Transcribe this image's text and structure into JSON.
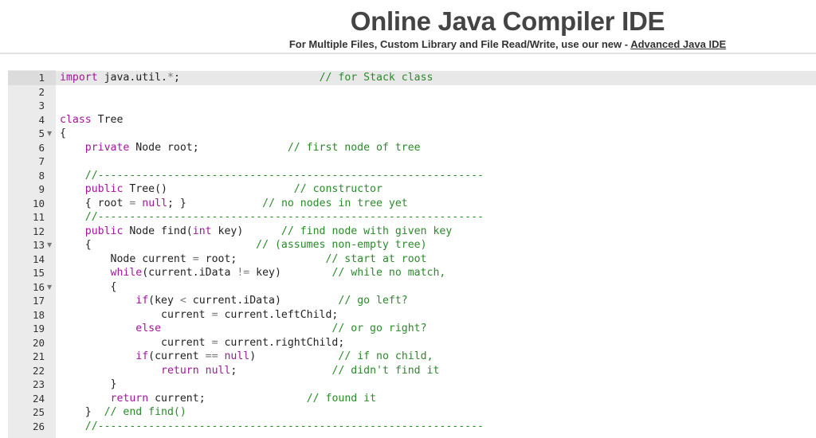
{
  "header": {
    "title": "Online Java Compiler IDE",
    "subtitle_prefix": "For Multiple Files, Custom Library and File Read/Write, use our new - ",
    "subtitle_link": "Advanced Java IDE"
  },
  "editor": {
    "lines": [
      {
        "n": "1",
        "fold": false,
        "tokens": [
          {
            "t": "kw",
            "v": "import"
          },
          {
            "t": "",
            "v": " java.util."
          },
          {
            "t": "op",
            "v": "*"
          },
          {
            "t": "",
            "v": ";"
          },
          {
            "t": "",
            "v": "                      "
          },
          {
            "t": "cm",
            "v": "// for Stack class"
          }
        ]
      },
      {
        "n": "2",
        "fold": false,
        "tokens": []
      },
      {
        "n": "3",
        "fold": false,
        "tokens": []
      },
      {
        "n": "4",
        "fold": false,
        "tokens": [
          {
            "t": "kw",
            "v": "class"
          },
          {
            "t": "",
            "v": " Tree"
          }
        ]
      },
      {
        "n": "5",
        "fold": true,
        "tokens": [
          {
            "t": "",
            "v": "{"
          }
        ]
      },
      {
        "n": "6",
        "fold": false,
        "tokens": [
          {
            "t": "",
            "v": "    "
          },
          {
            "t": "kw",
            "v": "private"
          },
          {
            "t": "",
            "v": " Node root;"
          },
          {
            "t": "",
            "v": "              "
          },
          {
            "t": "cm",
            "v": "// first node of tree"
          }
        ]
      },
      {
        "n": "7",
        "fold": false,
        "tokens": []
      },
      {
        "n": "8",
        "fold": false,
        "tokens": [
          {
            "t": "",
            "v": "    "
          },
          {
            "t": "cm",
            "v": "//-------------------------------------------------------------"
          }
        ]
      },
      {
        "n": "9",
        "fold": false,
        "tokens": [
          {
            "t": "",
            "v": "    "
          },
          {
            "t": "kw",
            "v": "public"
          },
          {
            "t": "",
            "v": " Tree()"
          },
          {
            "t": "",
            "v": "                    "
          },
          {
            "t": "cm",
            "v": "// constructor"
          }
        ]
      },
      {
        "n": "10",
        "fold": false,
        "tokens": [
          {
            "t": "",
            "v": "    { root "
          },
          {
            "t": "op",
            "v": "="
          },
          {
            "t": "",
            "v": " "
          },
          {
            "t": "kw",
            "v": "null"
          },
          {
            "t": "",
            "v": "; }"
          },
          {
            "t": "",
            "v": "            "
          },
          {
            "t": "cm",
            "v": "// no nodes in tree yet"
          }
        ]
      },
      {
        "n": "11",
        "fold": false,
        "tokens": [
          {
            "t": "",
            "v": "    "
          },
          {
            "t": "cm",
            "v": "//-------------------------------------------------------------"
          }
        ]
      },
      {
        "n": "12",
        "fold": false,
        "tokens": [
          {
            "t": "",
            "v": "    "
          },
          {
            "t": "kw",
            "v": "public"
          },
          {
            "t": "",
            "v": " Node find("
          },
          {
            "t": "kw",
            "v": "int"
          },
          {
            "t": "",
            "v": " key)"
          },
          {
            "t": "",
            "v": "      "
          },
          {
            "t": "cm",
            "v": "// find node with given key"
          }
        ]
      },
      {
        "n": "13",
        "fold": true,
        "tokens": [
          {
            "t": "",
            "v": "    {"
          },
          {
            "t": "",
            "v": "                          "
          },
          {
            "t": "cm",
            "v": "// (assumes non-empty tree)"
          }
        ]
      },
      {
        "n": "14",
        "fold": false,
        "tokens": [
          {
            "t": "",
            "v": "        Node current "
          },
          {
            "t": "op",
            "v": "="
          },
          {
            "t": "",
            "v": " root;"
          },
          {
            "t": "",
            "v": "              "
          },
          {
            "t": "cm",
            "v": "// start at root"
          }
        ]
      },
      {
        "n": "15",
        "fold": false,
        "tokens": [
          {
            "t": "",
            "v": "        "
          },
          {
            "t": "kw",
            "v": "while"
          },
          {
            "t": "",
            "v": "(current.iData "
          },
          {
            "t": "op",
            "v": "!="
          },
          {
            "t": "",
            "v": " key)"
          },
          {
            "t": "",
            "v": "        "
          },
          {
            "t": "cm",
            "v": "// while no match,"
          }
        ]
      },
      {
        "n": "16",
        "fold": true,
        "tokens": [
          {
            "t": "",
            "v": "        {"
          }
        ]
      },
      {
        "n": "17",
        "fold": false,
        "tokens": [
          {
            "t": "",
            "v": "            "
          },
          {
            "t": "kw",
            "v": "if"
          },
          {
            "t": "",
            "v": "(key "
          },
          {
            "t": "op",
            "v": "<"
          },
          {
            "t": "",
            "v": " current.iData)"
          },
          {
            "t": "",
            "v": "         "
          },
          {
            "t": "cm",
            "v": "// go left?"
          }
        ]
      },
      {
        "n": "18",
        "fold": false,
        "tokens": [
          {
            "t": "",
            "v": "                current "
          },
          {
            "t": "op",
            "v": "="
          },
          {
            "t": "",
            "v": " current.leftChild;"
          }
        ]
      },
      {
        "n": "19",
        "fold": false,
        "tokens": [
          {
            "t": "",
            "v": "            "
          },
          {
            "t": "kw",
            "v": "else"
          },
          {
            "t": "",
            "v": "                           "
          },
          {
            "t": "cm",
            "v": "// or go right?"
          }
        ]
      },
      {
        "n": "20",
        "fold": false,
        "tokens": [
          {
            "t": "",
            "v": "                current "
          },
          {
            "t": "op",
            "v": "="
          },
          {
            "t": "",
            "v": " current.rightChild;"
          }
        ]
      },
      {
        "n": "21",
        "fold": false,
        "tokens": [
          {
            "t": "",
            "v": "            "
          },
          {
            "t": "kw",
            "v": "if"
          },
          {
            "t": "",
            "v": "(current "
          },
          {
            "t": "op",
            "v": "=="
          },
          {
            "t": "",
            "v": " "
          },
          {
            "t": "kw",
            "v": "null"
          },
          {
            "t": "",
            "v": ")"
          },
          {
            "t": "",
            "v": "             "
          },
          {
            "t": "cm",
            "v": "// if no child,"
          }
        ]
      },
      {
        "n": "22",
        "fold": false,
        "tokens": [
          {
            "t": "",
            "v": "                "
          },
          {
            "t": "kw",
            "v": "return"
          },
          {
            "t": "",
            "v": " "
          },
          {
            "t": "kw",
            "v": "null"
          },
          {
            "t": "",
            "v": ";"
          },
          {
            "t": "",
            "v": "               "
          },
          {
            "t": "cm",
            "v": "// didn't find it"
          }
        ]
      },
      {
        "n": "23",
        "fold": false,
        "tokens": [
          {
            "t": "",
            "v": "        }"
          }
        ]
      },
      {
        "n": "24",
        "fold": false,
        "tokens": [
          {
            "t": "",
            "v": "        "
          },
          {
            "t": "kw",
            "v": "return"
          },
          {
            "t": "",
            "v": " current;"
          },
          {
            "t": "",
            "v": "                "
          },
          {
            "t": "cm",
            "v": "// found it"
          }
        ]
      },
      {
        "n": "25",
        "fold": false,
        "tokens": [
          {
            "t": "",
            "v": "    }  "
          },
          {
            "t": "cm",
            "v": "// end find()"
          }
        ]
      },
      {
        "n": "26",
        "fold": false,
        "tokens": [
          {
            "t": "",
            "v": "    "
          },
          {
            "t": "cm",
            "v": "//-------------------------------------------------------------"
          }
        ]
      }
    ]
  }
}
